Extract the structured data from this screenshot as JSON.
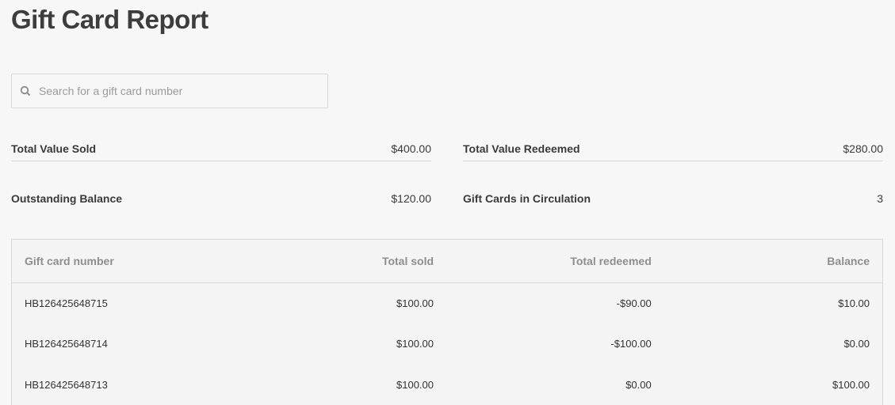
{
  "title": "Gift Card Report",
  "search": {
    "placeholder": "Search for a gift card number",
    "value": ""
  },
  "stats": [
    {
      "label": "Total Value Sold",
      "value": "$400.00"
    },
    {
      "label": "Total Value Redeemed",
      "value": "$280.00"
    },
    {
      "label": "Outstanding Balance",
      "value": "$120.00"
    },
    {
      "label": "Gift Cards in Circulation",
      "value": "3"
    }
  ],
  "table": {
    "headers": [
      "Gift card number",
      "Total sold",
      "Total redeemed",
      "Balance"
    ],
    "rows": [
      [
        "HB126425648715",
        "$100.00",
        "-$90.00",
        "$10.00"
      ],
      [
        "HB126425648714",
        "$100.00",
        "-$100.00",
        "$0.00"
      ],
      [
        "HB126425648713",
        "$100.00",
        "$0.00",
        "$100.00"
      ]
    ]
  }
}
